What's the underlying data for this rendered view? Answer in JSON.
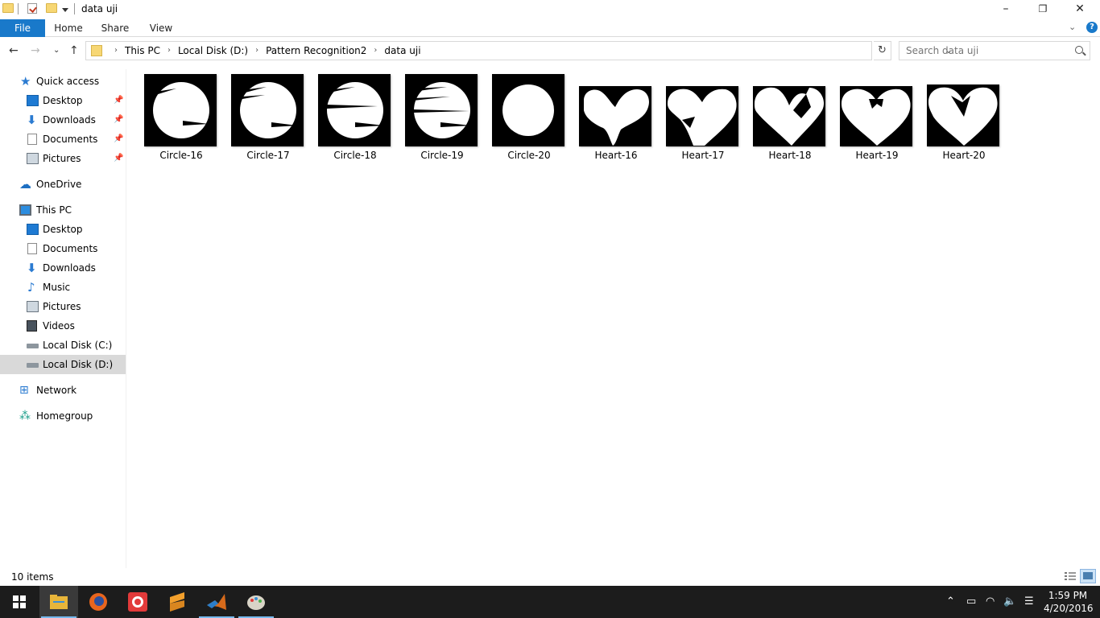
{
  "window": {
    "title": "data uji",
    "controls": {
      "minimize": "–",
      "maximize": "❐",
      "close": "✕"
    }
  },
  "ribbon": {
    "tabs": [
      "File",
      "Home",
      "Share",
      "View"
    ],
    "expand_icon": "chevron-down",
    "help": "?"
  },
  "address": {
    "crumbs": [
      "This PC",
      "Local Disk (D:)",
      "Pattern Recognition2",
      "data uji"
    ],
    "search_placeholder": "Search data uji"
  },
  "nav": {
    "quick_access": "Quick access",
    "quick_items": [
      "Desktop",
      "Downloads",
      "Documents",
      "Pictures"
    ],
    "onedrive": "OneDrive",
    "this_pc": "This PC",
    "pc_items": [
      "Desktop",
      "Documents",
      "Downloads",
      "Music",
      "Pictures",
      "Videos",
      "Local Disk (C:)",
      "Local Disk (D:)"
    ],
    "network": "Network",
    "homegroup": "Homegroup",
    "selected": "Local Disk (D:)"
  },
  "files": [
    {
      "name": "Circle-16",
      "shape": "circle"
    },
    {
      "name": "Circle-17",
      "shape": "circle"
    },
    {
      "name": "Circle-18",
      "shape": "circle"
    },
    {
      "name": "Circle-19",
      "shape": "circle"
    },
    {
      "name": "Circle-20",
      "shape": "circle"
    },
    {
      "name": "Heart-16",
      "shape": "heart"
    },
    {
      "name": "Heart-17",
      "shape": "heart"
    },
    {
      "name": "Heart-18",
      "shape": "heart"
    },
    {
      "name": "Heart-19",
      "shape": "heart"
    },
    {
      "name": "Heart-20",
      "shape": "heart"
    }
  ],
  "status": {
    "item_count": "10 items"
  },
  "taskbar": {
    "apps": [
      "start-icon",
      "file-explorer-icon",
      "firefox-icon",
      "screen-recorder-icon",
      "sublime-icon",
      "matlab-icon",
      "paint-icon"
    ],
    "time": "1:59 PM",
    "date": "4/20/2016"
  },
  "colors": {
    "accent": "#1979ca",
    "taskbar": "#1c1c1c",
    "selection": "#d9d9d9"
  }
}
